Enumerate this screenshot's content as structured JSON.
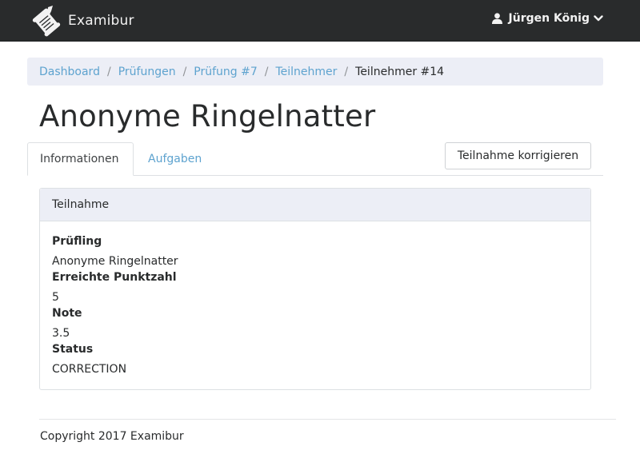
{
  "navbar": {
    "brand": "Examibur",
    "brand_icon": "scroll-quill-logo-icon",
    "user_name": "Jürgen König",
    "user_icon": "user-icon",
    "menu_icon": "chevron-down-icon"
  },
  "breadcrumb": [
    {
      "label": "Dashboard"
    },
    {
      "label": "Prüfungen"
    },
    {
      "label": "Prüfung #7"
    },
    {
      "label": "Teilnehmer"
    },
    {
      "label": "Teilnehmer #14"
    }
  ],
  "page_title": "Anonyme Ringelnatter",
  "tabs": [
    {
      "label": "Informationen",
      "active": true
    },
    {
      "label": "Aufgaben",
      "active": false
    }
  ],
  "actions": {
    "correct_label": "Teilnahme korrigieren"
  },
  "card": {
    "header": "Teilnahme",
    "fields": [
      {
        "label": "Prüfling",
        "value": "Anonyme Ringelnatter"
      },
      {
        "label": "Erreichte Punktzahl",
        "value": "5"
      },
      {
        "label": "Note",
        "value": "3.5"
      },
      {
        "label": "Status",
        "value": "CORRECTION"
      }
    ]
  },
  "footer": "Copyright 2017 Examibur",
  "colors": {
    "navbar": "#292b2c",
    "link": "#5ea3cf",
    "breadcrumb_bg": "#eceef6"
  }
}
